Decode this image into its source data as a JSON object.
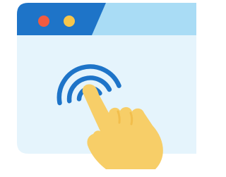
{
  "illustration": {
    "subject": "browser-window-tap-icon",
    "icons": {
      "window": "browser-window-icon",
      "dots": [
        "close-dot-icon",
        "minimize-dot-icon"
      ],
      "waves": "touch-waves-icon",
      "hand": "pointing-hand-icon"
    },
    "colors": {
      "title_bar": "#1E74C8",
      "tab": "#A9DCF5",
      "window_body": "#E5F4FC",
      "dot_red": "#F15B40",
      "dot_yellow": "#F7C64A",
      "waves": "#1E74C8",
      "hand": "#F7CE68",
      "hand_shade": "#F2BE4C"
    }
  }
}
